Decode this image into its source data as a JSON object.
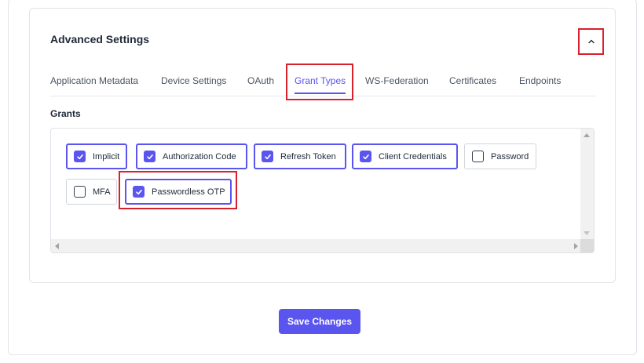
{
  "advanced_settings": {
    "title": "Advanced Settings",
    "collapse_icon": "chevron-up-icon"
  },
  "tabs": [
    {
      "label": "Application Metadata",
      "active": false
    },
    {
      "label": "Device Settings",
      "active": false
    },
    {
      "label": "OAuth",
      "active": false
    },
    {
      "label": "Grant Types",
      "active": true
    },
    {
      "label": "WS-Federation",
      "active": false
    },
    {
      "label": "Certificates",
      "active": false
    },
    {
      "label": "Endpoints",
      "active": false
    }
  ],
  "grants": {
    "label": "Grants",
    "items": [
      {
        "label": "Implicit",
        "checked": true
      },
      {
        "label": "Authorization Code",
        "checked": true
      },
      {
        "label": "Refresh Token",
        "checked": true
      },
      {
        "label": "Client Credentials",
        "checked": true
      },
      {
        "label": "Password",
        "checked": false
      },
      {
        "label": "MFA",
        "checked": false
      },
      {
        "label": "Passwordless OTP",
        "checked": true
      }
    ]
  },
  "actions": {
    "save_label": "Save Changes"
  },
  "colors": {
    "accent": "#5a55ef",
    "highlight": "#d9202d",
    "border": "#e2e4e9"
  }
}
